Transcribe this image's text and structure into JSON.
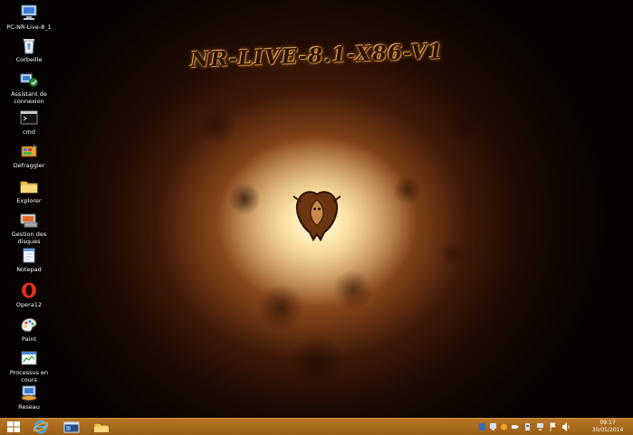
{
  "wallpaper": {
    "title": "NR-LIVE-8.1-X86-V1"
  },
  "desktop_icons": [
    {
      "label": "PC-NR-Live-8_1",
      "icon": "computer-icon"
    },
    {
      "label": "Corbeille",
      "icon": "recycle-bin-icon"
    },
    {
      "label": "Assistant de connexion",
      "icon": "network-wizard-icon"
    },
    {
      "label": "cmd",
      "icon": "command-prompt-icon"
    },
    {
      "label": "Defraggler",
      "icon": "defraggler-icon"
    },
    {
      "label": "Explorer",
      "icon": "folder-icon"
    },
    {
      "label": "Gestion des disques",
      "icon": "disk-management-icon"
    },
    {
      "label": "Notepad",
      "icon": "notepad-icon"
    },
    {
      "label": "Opera12",
      "icon": "opera-icon"
    },
    {
      "label": "Paint",
      "icon": "paint-icon"
    },
    {
      "label": "Processus en cours",
      "icon": "task-manager-icon"
    },
    {
      "label": "Reseau",
      "icon": "network-icon"
    }
  ],
  "taskbar": {
    "buttons": [
      "start-windows-icon",
      "internet-explorer-icon",
      "computer-window-icon",
      "file-explorer-icon"
    ],
    "tray_icons": [
      "tray-app-icon",
      "tray-network-icon",
      "tray-media-icon",
      "tray-power-icon",
      "tray-usb-icon",
      "tray-display-icon",
      "tray-flag-icon",
      "tray-volume-icon"
    ],
    "clock": {
      "time": "09:17",
      "date": "30/05/2014"
    }
  },
  "colors": {
    "taskbar": "#a8671c",
    "wallpaper_glow": "#fff3d0",
    "icon_label": "#ffffff"
  }
}
